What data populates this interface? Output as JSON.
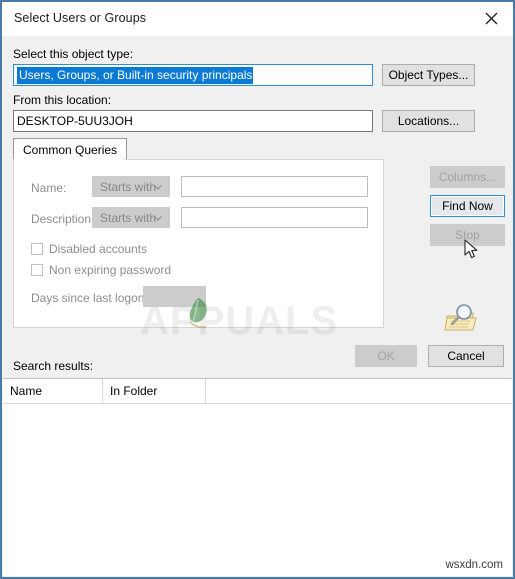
{
  "window": {
    "title": "Select Users or Groups",
    "close_icon": "close-icon",
    "border_color": "#4a7ba7"
  },
  "object_type": {
    "label": "Select this object type:",
    "value": "Users, Groups, or Built-in security principals",
    "selected": true,
    "button_label": "Object Types..."
  },
  "location": {
    "label": "From this location:",
    "value": "DESKTOP-5UU3JOH",
    "button_label": "Locations..."
  },
  "tabs": [
    {
      "label": "Common Queries",
      "active": true
    }
  ],
  "query": {
    "name": {
      "label": "Name:",
      "operator": "Starts with",
      "value": "",
      "placeholder": ""
    },
    "description": {
      "label": "Description:",
      "operator": "Starts with",
      "value": "",
      "placeholder": ""
    },
    "checkboxes": [
      {
        "label": "Disabled accounts",
        "checked": false
      },
      {
        "label": "Non expiring password",
        "checked": false
      }
    ],
    "days_since_last_logon": {
      "label": "Days since last logon:",
      "value": ""
    }
  },
  "side_buttons": [
    {
      "label": "Columns...",
      "state": "disabled"
    },
    {
      "label": "Find Now",
      "state": "focused"
    },
    {
      "label": "Stop",
      "state": "disabled"
    }
  ],
  "icons": {
    "search_graphic": "magnifier-folder-icon"
  },
  "dialog_buttons": {
    "ok": {
      "label": "OK",
      "state": "disabled"
    },
    "cancel": {
      "label": "Cancel",
      "state": "normal"
    }
  },
  "results": {
    "label": "Search results:",
    "columns": [
      "Name",
      "In Folder"
    ],
    "rows": []
  },
  "watermarks": {
    "brand": "APPUALS",
    "site": "wsxdn.com"
  },
  "colors": {
    "accent": "#0a7ad4",
    "focus_border": "#2b8fd6",
    "dialog_bg": "#f0f0f0",
    "disabled_bg": "#cccccc",
    "disabled_text": "#8d8d8d"
  }
}
